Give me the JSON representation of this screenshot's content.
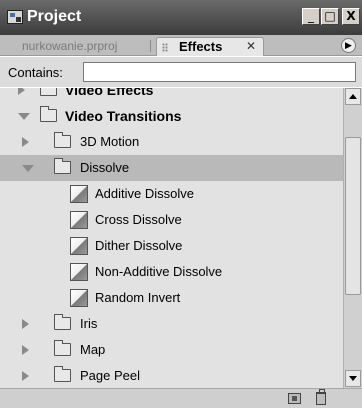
{
  "window": {
    "title": "Project",
    "controls": {
      "minimize": "_",
      "maximize": "□",
      "close": "X"
    }
  },
  "tabs": [
    {
      "label": "nurkowanie.prproj",
      "active": false
    },
    {
      "label": "Effects",
      "active": true,
      "close": "✕"
    }
  ],
  "panel_menu_icon": "flyout-menu-icon",
  "search": {
    "label": "Contains:",
    "value": "",
    "placeholder": ""
  },
  "tree": [
    {
      "label": "Video Effects",
      "kind": "folder",
      "level": 0,
      "expanded": false,
      "bold": true,
      "selected": false
    },
    {
      "label": "Video Transitions",
      "kind": "folder",
      "level": 0,
      "expanded": true,
      "bold": true,
      "selected": false
    },
    {
      "label": "3D Motion",
      "kind": "folder",
      "level": 1,
      "expanded": false,
      "bold": false,
      "selected": false
    },
    {
      "label": "Dissolve",
      "kind": "folder",
      "level": 1,
      "expanded": true,
      "bold": false,
      "selected": true
    },
    {
      "label": "Additive Dissolve",
      "kind": "effect",
      "level": 2,
      "bold": false,
      "selected": false
    },
    {
      "label": "Cross Dissolve",
      "kind": "effect",
      "level": 2,
      "bold": false,
      "selected": false
    },
    {
      "label": "Dither Dissolve",
      "kind": "effect",
      "level": 2,
      "bold": false,
      "selected": false
    },
    {
      "label": "Non-Additive Dissolve",
      "kind": "effect",
      "level": 2,
      "bold": false,
      "selected": false
    },
    {
      "label": "Random Invert",
      "kind": "effect",
      "level": 2,
      "bold": false,
      "selected": false
    },
    {
      "label": "Iris",
      "kind": "folder",
      "level": 1,
      "expanded": false,
      "bold": false,
      "selected": false
    },
    {
      "label": "Map",
      "kind": "folder",
      "level": 1,
      "expanded": false,
      "bold": false,
      "selected": false
    },
    {
      "label": "Page Peel",
      "kind": "folder",
      "level": 1,
      "expanded": false,
      "bold": false,
      "selected": false
    }
  ],
  "scrollbar": {
    "position_fraction": 0.12,
    "visible_fraction": 0.6
  },
  "footer_icons": [
    "new-custom-bin-icon",
    "delete-icon"
  ],
  "colors": {
    "titlebar": "#4a4a4a",
    "selected_row": "#b9b9b9",
    "tree_background": "#e2e2e2"
  }
}
